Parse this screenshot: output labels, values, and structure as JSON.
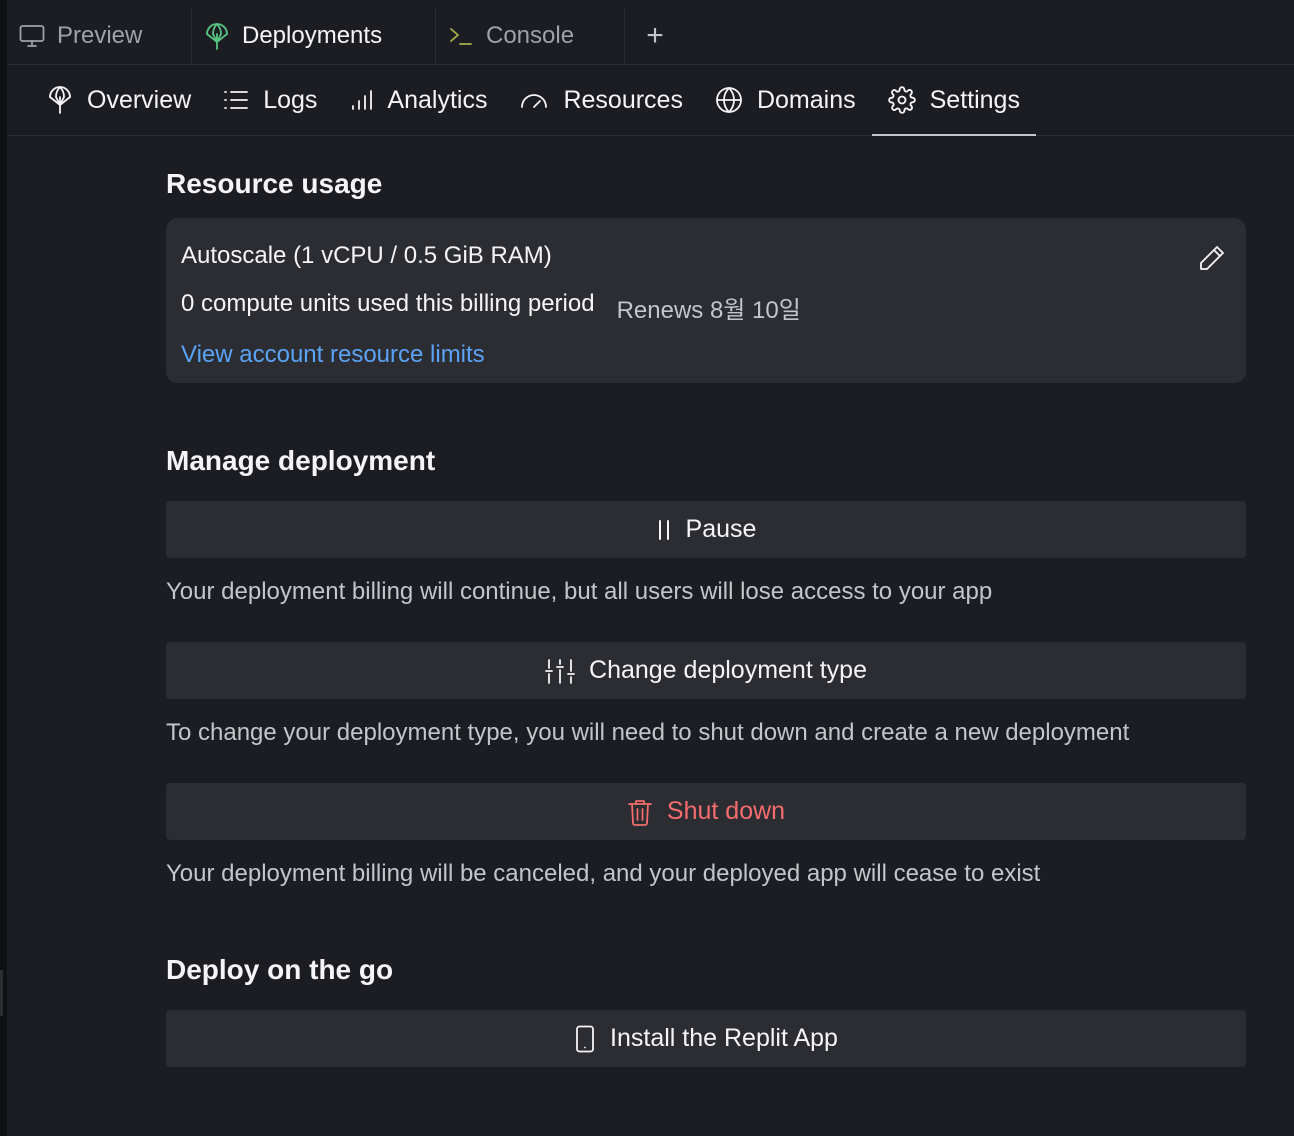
{
  "tabs": {
    "preview": "Preview",
    "deployments": "Deployments",
    "console": "Console",
    "add": "+"
  },
  "nav": {
    "overview": "Overview",
    "logs": "Logs",
    "analytics": "Analytics",
    "resources": "Resources",
    "domains": "Domains",
    "settings": "Settings",
    "active": "Settings"
  },
  "resource_usage": {
    "title": "Resource usage",
    "plan": "Autoscale (1 vCPU / 0.5 GiB RAM)",
    "usage": "0 compute units used this billing period",
    "renews": "Renews 8월 10일",
    "link": "View account resource limits"
  },
  "manage": {
    "title": "Manage deployment",
    "pause_label": "Pause",
    "pause_desc": "Your deployment billing will continue, but all users will lose access to your app",
    "change_label": "Change deployment type",
    "change_desc": "To change your deployment type, you will need to shut down and create a new deployment",
    "shutdown_label": "Shut down",
    "shutdown_desc": "Your deployment billing will be canceled, and your deployed app will cease to exist"
  },
  "mobile": {
    "title": "Deploy on the go",
    "install_label": "Install the Replit App"
  },
  "colors": {
    "background": "#1c1d22",
    "surface": "#2b2d33",
    "link": "#5ba3f5",
    "danger": "#f46c6c",
    "deploy_icon": "#58c484"
  }
}
